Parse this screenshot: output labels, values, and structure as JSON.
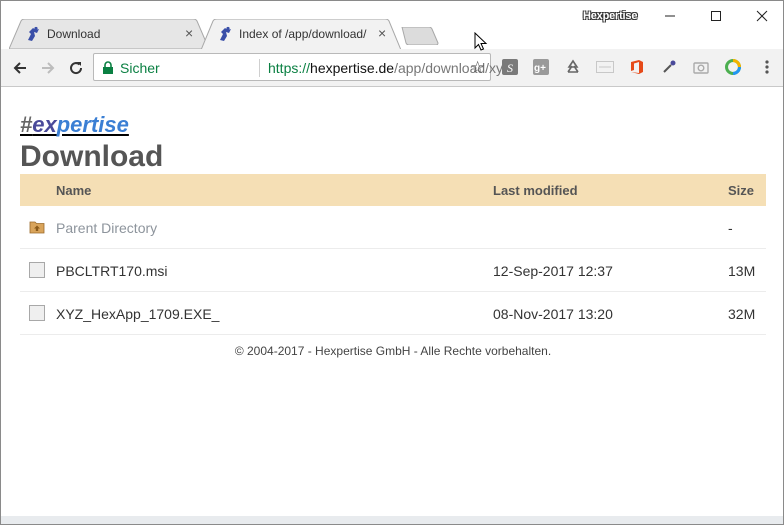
{
  "tabs": [
    {
      "title": "Download",
      "close": "×",
      "active": false
    },
    {
      "title": "Index of /app/download/",
      "close": "×",
      "active": true
    }
  ],
  "profile_name": "Hexpertise",
  "omnibox": {
    "secure_label": "Sicher",
    "url_scheme": "https://",
    "url_host": "hexpertise.de",
    "url_path": "/app/download/xyz/"
  },
  "page": {
    "logo": {
      "hash": "#",
      "ex": "ex",
      "pert": "pertise"
    },
    "heading": "Download",
    "columns": {
      "name": "Name",
      "modified": "Last modified",
      "size": "Size"
    },
    "rows": [
      {
        "icon": "folder-up-icon",
        "name": "Parent Directory",
        "modified": "",
        "size": "-"
      },
      {
        "icon": "file-icon",
        "name": "PBCLTRT170.msi",
        "modified": "12-Sep-2017 12:37",
        "size": "13M"
      },
      {
        "icon": "file-icon",
        "name": "XYZ_HexApp_1709.EXE_",
        "modified": "08-Nov-2017 13:20",
        "size": "32M"
      }
    ],
    "footer": "© 2004-2017 - Hexpertise GmbH - Alle Rechte vorbehalten."
  },
  "colors": {
    "header_bg": "#f5dfb5",
    "secure_green": "#0b8043",
    "logo_blue": "#3b7fd4"
  }
}
